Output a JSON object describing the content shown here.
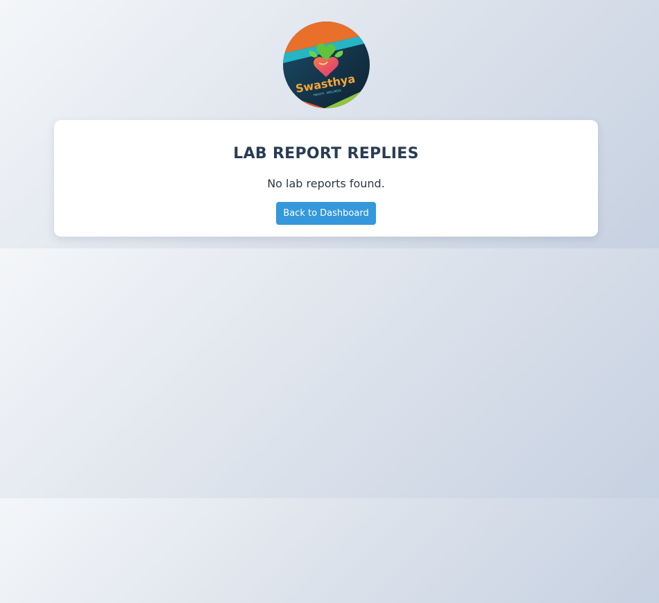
{
  "logo": {
    "brand_text": "Swasthya",
    "tagline": "HEALTH · WELLNESS",
    "icon": "heart-leaves-logo"
  },
  "card": {
    "title": "LAB REPORT REPLIES",
    "message": "No lab reports found.",
    "back_button_label": "Back to Dashboard"
  },
  "colors": {
    "accent": "#3498db",
    "title": "#283d54",
    "text": "#2f3640"
  }
}
